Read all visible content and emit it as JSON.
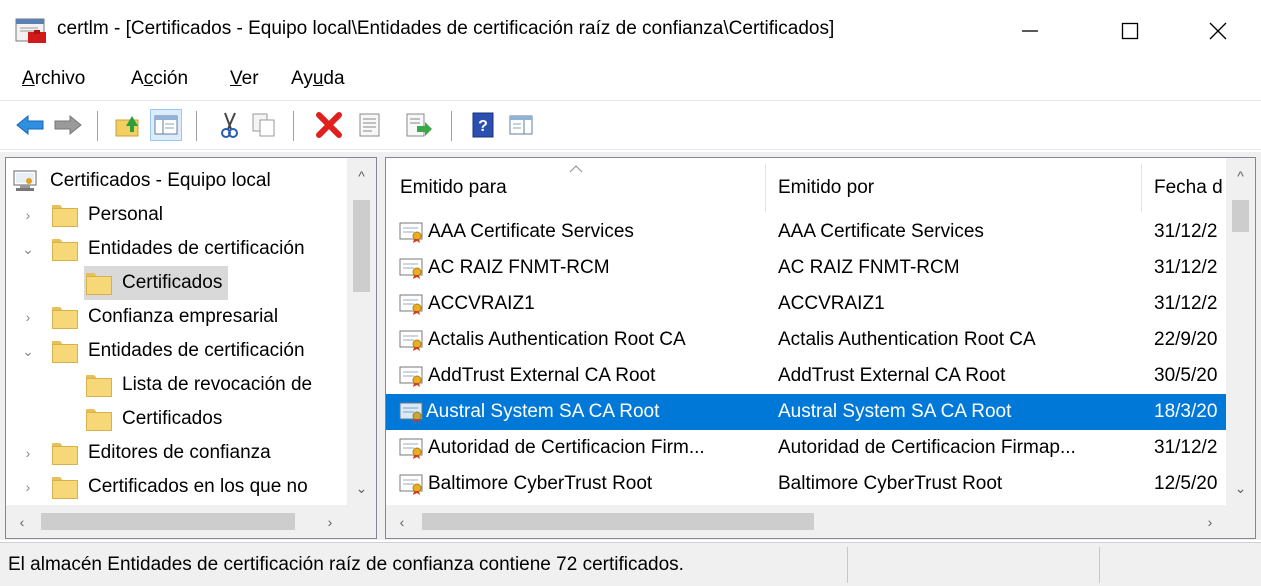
{
  "window": {
    "title": "certlm - [Certificados - Equipo local\\Entidades de certificación raíz de confianza\\Certificados]"
  },
  "menu": [
    {
      "pre": "",
      "key": "A",
      "post": "rchivo"
    },
    {
      "pre": "A",
      "key": "c",
      "post": "ción"
    },
    {
      "pre": "",
      "key": "V",
      "post": "er"
    },
    {
      "pre": "Ay",
      "key": "u",
      "post": "da"
    }
  ],
  "toolbar": {
    "icons": [
      "back-arrow-icon",
      "forward-arrow-icon",
      "up-folder-icon",
      "show-hide-tree-icon",
      "cut-icon",
      "copy-icon",
      "delete-icon",
      "properties-icon",
      "export-list-icon",
      "help-icon",
      "action-pane-icon"
    ]
  },
  "tree": {
    "items": [
      {
        "label": "Certificados - Equipo local",
        "arrow": "",
        "level": 0,
        "icon": "certificate-store-icon"
      },
      {
        "label": "Personal",
        "arrow": "›",
        "level": 1,
        "icon": "folder-icon"
      },
      {
        "label": "Entidades de certificación",
        "arrow": "⌄",
        "level": 1,
        "icon": "folder-icon"
      },
      {
        "label": "Certificados",
        "arrow": "",
        "level": 2,
        "icon": "folder-icon",
        "selected": true
      },
      {
        "label": "Confianza empresarial",
        "arrow": "›",
        "level": 1,
        "icon": "folder-icon"
      },
      {
        "label": "Entidades de certificación",
        "arrow": "⌄",
        "level": 1,
        "icon": "folder-icon"
      },
      {
        "label": "Lista de revocación de",
        "arrow": "",
        "level": 2,
        "icon": "folder-icon"
      },
      {
        "label": "Certificados",
        "arrow": "",
        "level": 2,
        "icon": "folder-icon"
      },
      {
        "label": "Editores de confianza",
        "arrow": "›",
        "level": 1,
        "icon": "folder-icon"
      },
      {
        "label": "Certificados en los que no",
        "arrow": "›",
        "level": 1,
        "icon": "folder-icon"
      }
    ]
  },
  "list": {
    "columns": [
      "Emitido para",
      "Emitido por",
      "Fecha d"
    ],
    "rows": [
      {
        "issued_to": "AAA Certificate Services",
        "issued_by": "AAA Certificate Services",
        "date": "31/12/2"
      },
      {
        "issued_to": "AC RAIZ FNMT-RCM",
        "issued_by": "AC RAIZ FNMT-RCM",
        "date": "31/12/2"
      },
      {
        "issued_to": "ACCVRAIZ1",
        "issued_by": "ACCVRAIZ1",
        "date": "31/12/2"
      },
      {
        "issued_to": "Actalis Authentication Root CA",
        "issued_by": "Actalis Authentication Root CA",
        "date": "22/9/20"
      },
      {
        "issued_to": "AddTrust External CA Root",
        "issued_by": "AddTrust External CA Root",
        "date": "30/5/20"
      },
      {
        "issued_to": "Austral System SA CA Root",
        "issued_by": "Austral System SA CA Root",
        "date": "18/3/20",
        "selected": true
      },
      {
        "issued_to": "Autoridad de Certificacion Firm...",
        "issued_by": "Autoridad de Certificacion Firmap...",
        "date": "31/12/2"
      },
      {
        "issued_to": "Baltimore CyberTrust Root",
        "issued_by": "Baltimore CyberTrust Root",
        "date": "12/5/20"
      }
    ]
  },
  "status": {
    "text": "El almacén Entidades de certificación raíz de confianza contiene 72 certificados."
  },
  "colors": {
    "selection": "#0078d7",
    "tree_selection": "#d9d9d9",
    "pane_border": "#828790"
  }
}
